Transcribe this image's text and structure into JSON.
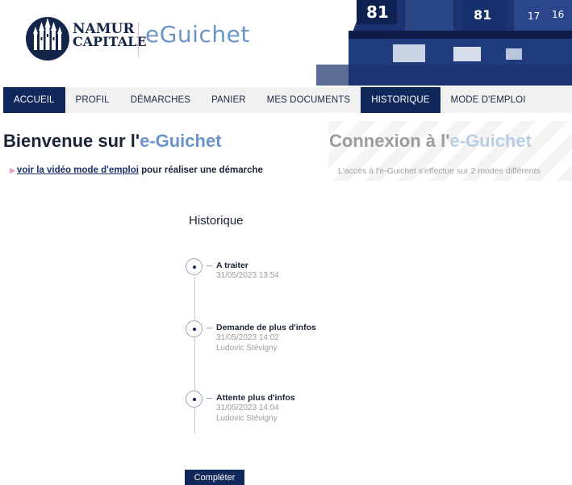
{
  "header": {
    "brand_line1": "NAMUR",
    "brand_line2": "CAPITALE",
    "app_name": "eGuichet",
    "banner_numbers": [
      "81",
      "81",
      "17",
      "16"
    ]
  },
  "nav": {
    "items": [
      {
        "label": "ACCUEIL",
        "active": true
      },
      {
        "label": "PROFIL",
        "active": false
      },
      {
        "label": "DÉMARCHES",
        "active": false
      },
      {
        "label": "PANIER",
        "active": false
      },
      {
        "label": "MES DOCUMENTS",
        "active": false
      },
      {
        "label": "HISTORIQUE",
        "active": true
      },
      {
        "label": "MODE D'EMPLOI",
        "active": false
      }
    ]
  },
  "welcome": {
    "title_prefix": "Bienvenue sur l'",
    "title_accent": "e-Guichet",
    "video_link": "voir la vidéo mode d'emploi",
    "video_suffix": " pour réaliser une démarche"
  },
  "login": {
    "title_prefix": "Connexion à l'",
    "title_accent": "e-Guichet",
    "subtitle": "L'accès à l'e-Guichet s'effectue sur 2 modes différents"
  },
  "history": {
    "title": "Historique",
    "events": [
      {
        "status": "A traiter",
        "date": "31/05/2023 13:54",
        "user": ""
      },
      {
        "status": "Demande de plus d'infos",
        "date": "31/05/2023 14:02",
        "user": "Ludovic Stévigny"
      },
      {
        "status": "Attente plus d'infos",
        "date": "31/05/2023 14:04",
        "user": "Ludovic Stévigny"
      }
    ]
  },
  "actions": {
    "complete_label": "Compléter"
  },
  "colors": {
    "navy": "#10285a",
    "accent_blue": "#6b94c9",
    "nav_bg": "#f1f1f1"
  }
}
